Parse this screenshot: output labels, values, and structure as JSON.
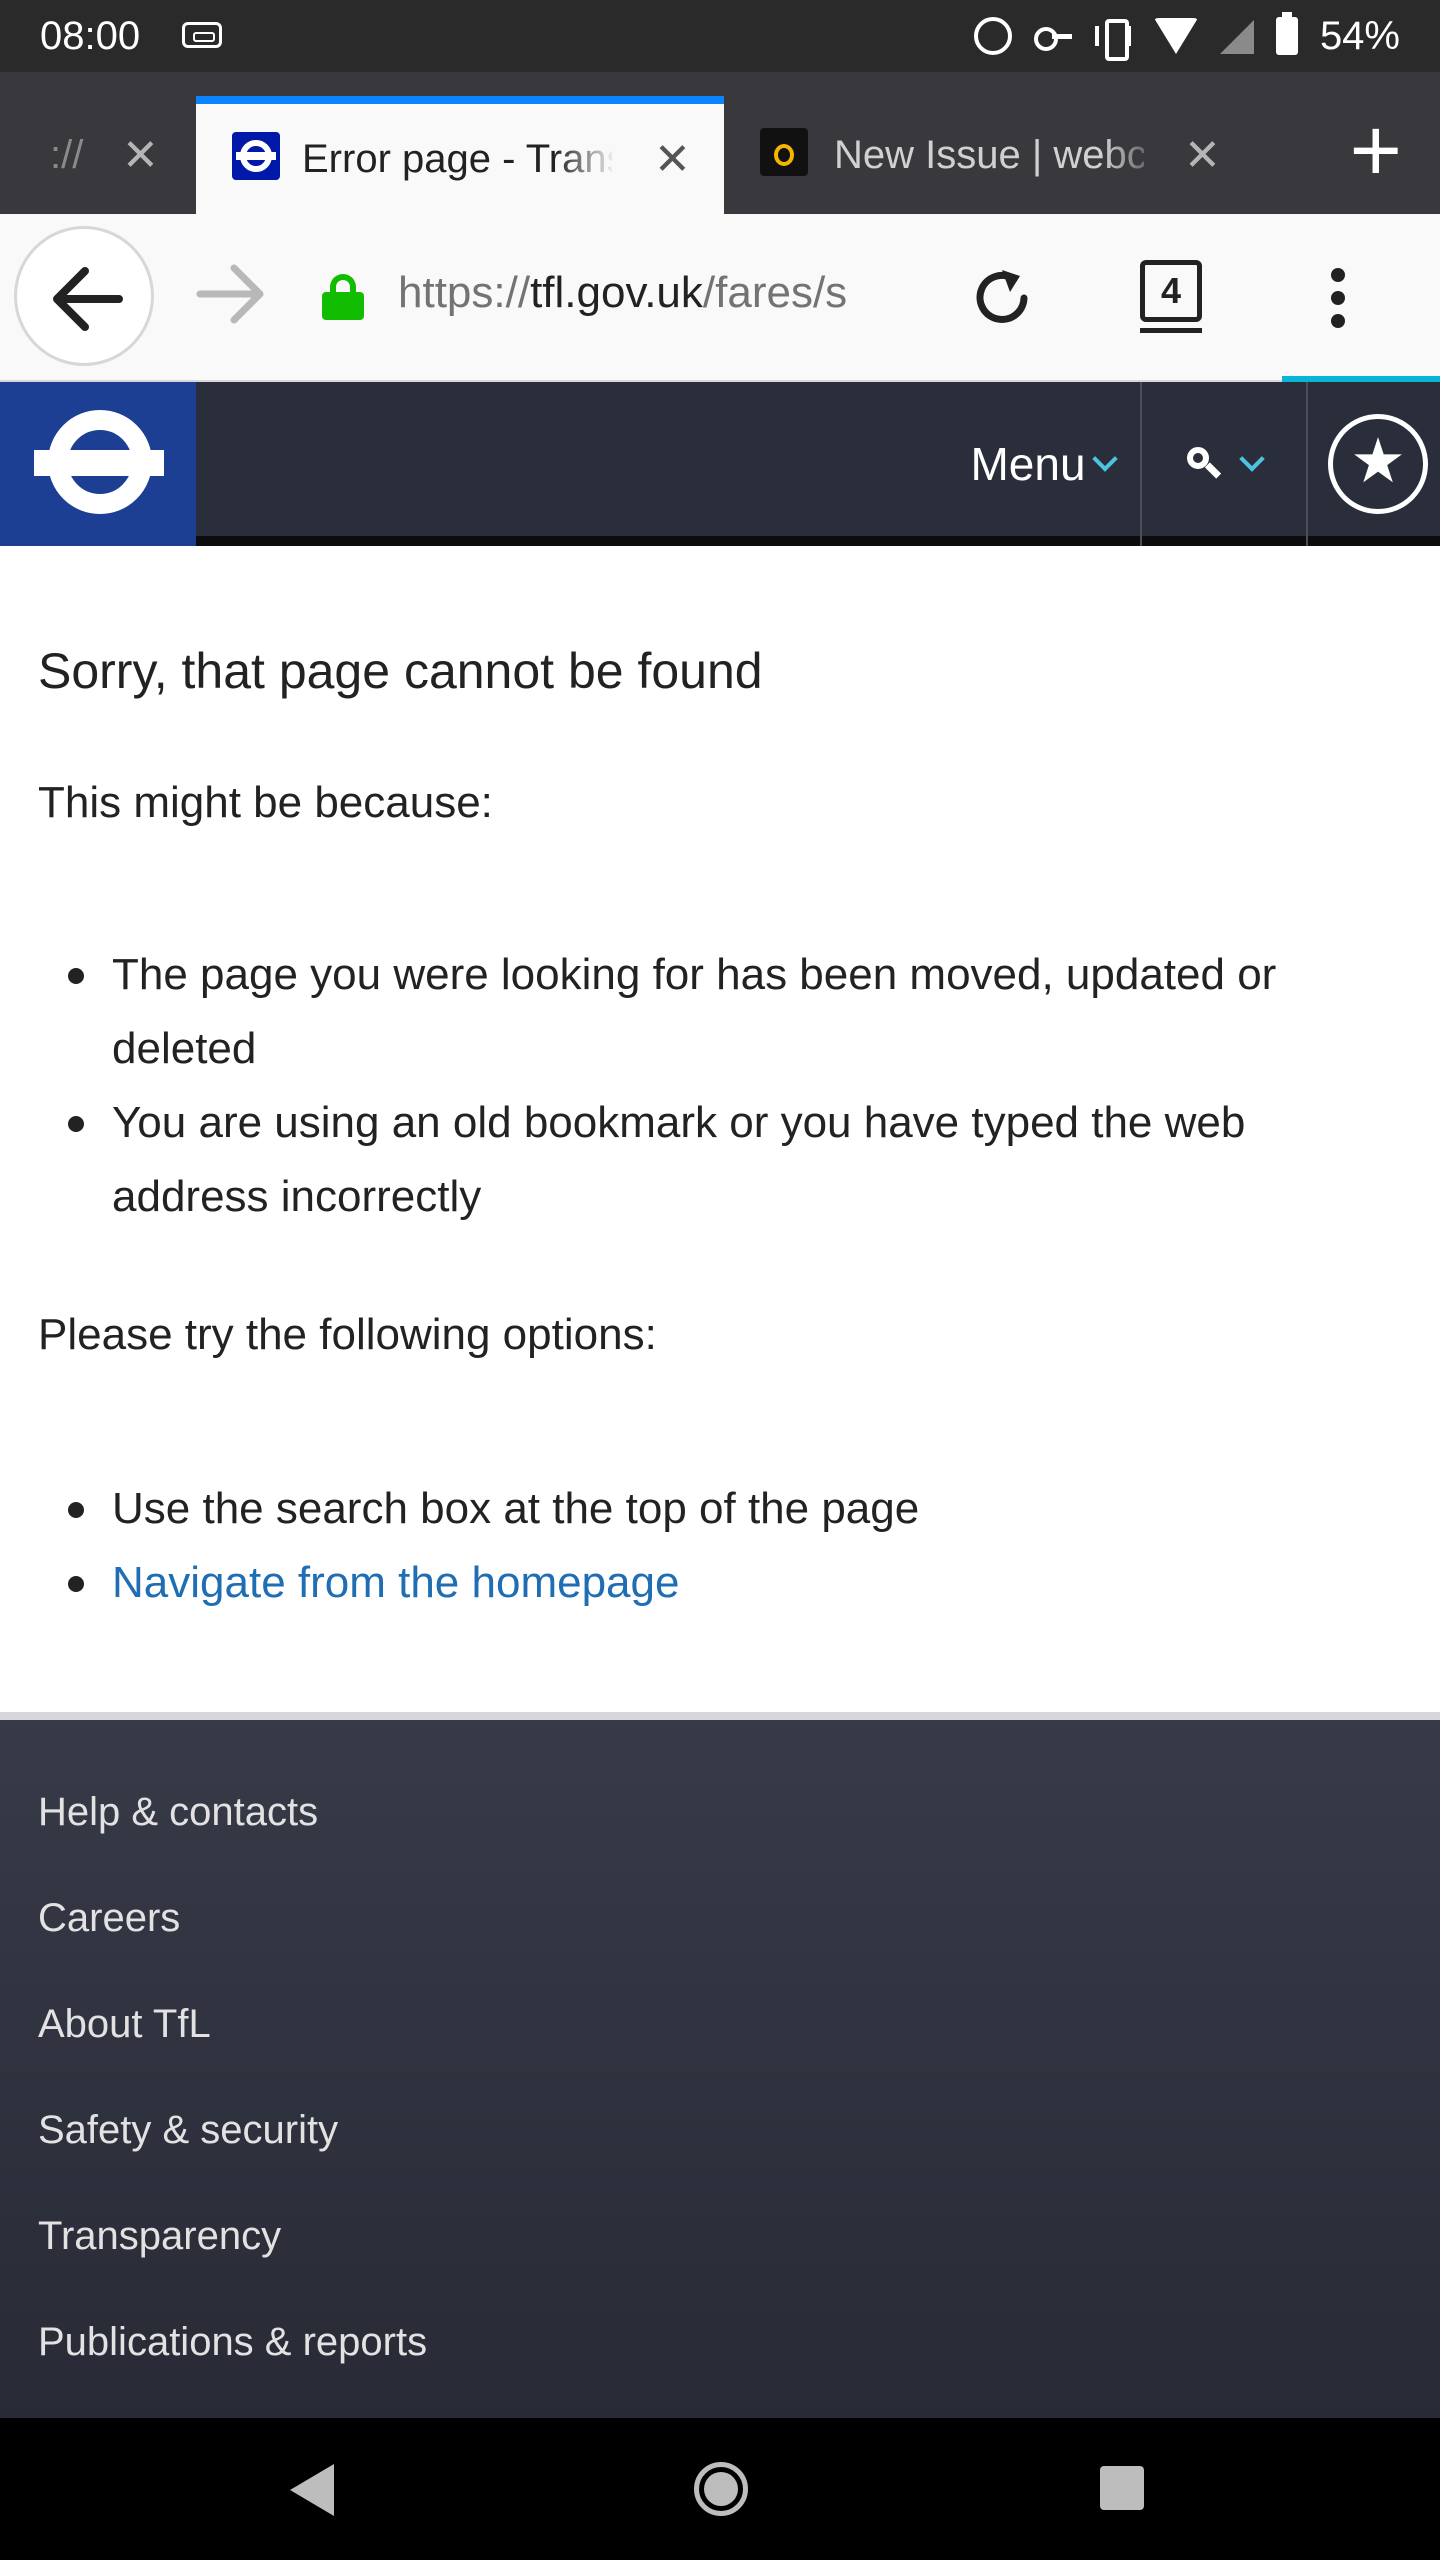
{
  "status_bar": {
    "time": "08:00",
    "battery": "54%",
    "icons": [
      "sd-card-icon",
      "alarm-icon",
      "key-icon",
      "vibrate-icon",
      "wifi-icon",
      "signal-icon",
      "battery-icon"
    ]
  },
  "tabs": [
    {
      "title": "://",
      "active": false
    },
    {
      "title": "Error page - Transport for London",
      "active": true,
      "favicon": "tfl-roundel-icon"
    },
    {
      "title": "New Issue | webcompat.com",
      "active": false,
      "favicon": "webcompat-icon"
    }
  ],
  "toolbar": {
    "url_scheme": "https://",
    "url_host": "tfl.gov.uk",
    "url_path": "/fares/s",
    "tab_count": "4"
  },
  "site_header": {
    "menu_label": "Menu",
    "colors": {
      "header_bg": "#2a2d3a",
      "logo_bg": "#1c3f94",
      "accent": "#4ec3e0"
    }
  },
  "content": {
    "heading": "Sorry, that page cannot be found",
    "intro": "This might be because:",
    "reasons": [
      "The page you were looking for has been moved, updated or deleted",
      "You are using an old bookmark or you have typed the web address incorrectly"
    ],
    "try_label": "Please try the following options:",
    "option_search": "Use the search box at the top of the page",
    "option_home_link": "Navigate from the homepage",
    "link_color": "#1f6eb3"
  },
  "footer": {
    "links": [
      "Help & contacts",
      "Careers",
      "About TfL",
      "Safety & security",
      "Transparency",
      "Publications & reports"
    ]
  }
}
